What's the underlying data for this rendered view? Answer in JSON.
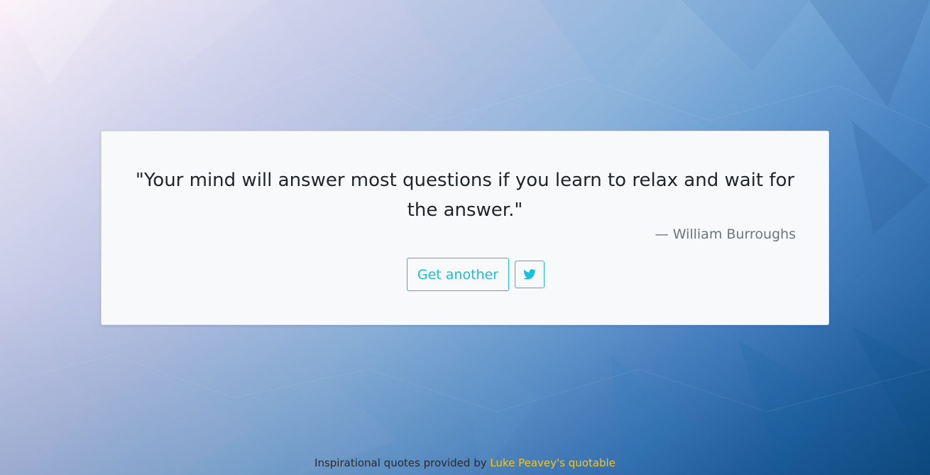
{
  "quote": {
    "text": "\"Your mind will answer most questions if you learn to relax and wait for the answer.\"",
    "author": "— William Burroughs"
  },
  "buttons": {
    "get_another": "Get another",
    "tweet_icon": "twitter-icon"
  },
  "footer": {
    "prefix": "Inspirational quotes provided by ",
    "link_text": "Luke Peavey's quotable"
  },
  "colors": {
    "accent": "#17c1d9",
    "link": "#f5c518",
    "card_bg": "#f8f9fa"
  }
}
